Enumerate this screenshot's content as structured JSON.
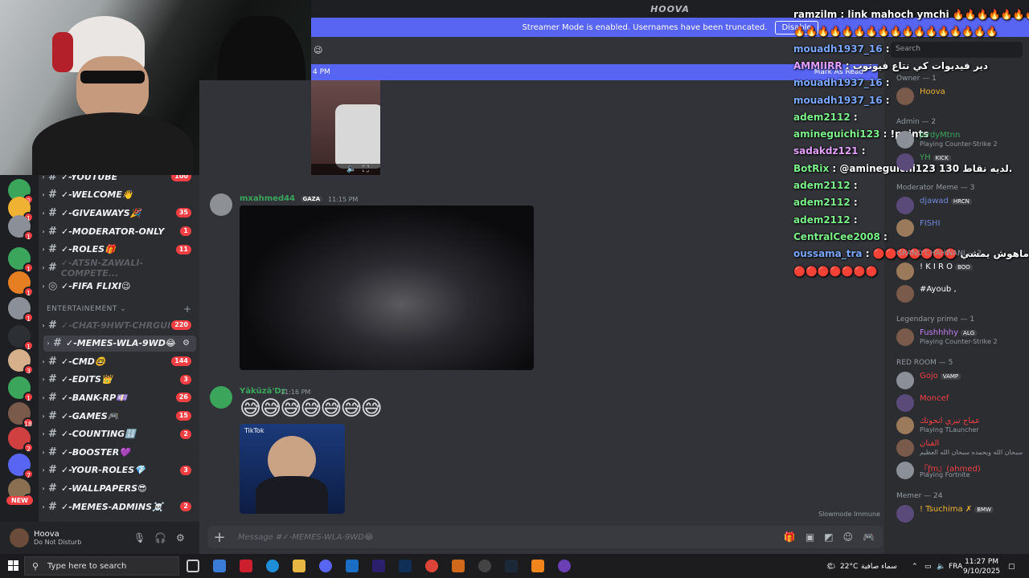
{
  "window": {
    "title": "HOOVA"
  },
  "streamer_mode": {
    "text": "Streamer Mode is enabled. Usernames have been truncated.",
    "button": "Disable"
  },
  "new_messages": {
    "time": "4 PM",
    "mark_read": "Mark As Read"
  },
  "channels": [
    {
      "name": "✓-YOUTUBE",
      "count": "100"
    },
    {
      "name": "✓-WELCOME👋",
      "count": ""
    },
    {
      "name": "✓-GIVEAWAYS🎉",
      "count": "35"
    },
    {
      "name": "✓-MODERATOR-ONLY",
      "count": "1"
    },
    {
      "name": "✓-ROLES🎁",
      "count": "11"
    },
    {
      "name": "✓-ATSN-ZAWALI-COMPETE...",
      "count": ""
    },
    {
      "name": "✓-FIFA FLIXI😉",
      "count": ""
    }
  ],
  "category": {
    "name": "ENTERTAINEMENT",
    "chevron": "⌄",
    "plus": "+"
  },
  "channels2": [
    {
      "name": "✓-CHAT-9HWT-CHRGUI",
      "count": "220"
    },
    {
      "name": "✓-MEMES-WLA-9WD😂",
      "count": ""
    },
    {
      "name": "✓-CMD🤓",
      "count": "144"
    },
    {
      "name": "✓-EDITS👑",
      "count": "3"
    },
    {
      "name": "✓-BANK-RP💷",
      "count": "26"
    },
    {
      "name": "✓-GAMES🎮",
      "count": "15"
    },
    {
      "name": "✓-COUNTING🔢",
      "count": "2"
    },
    {
      "name": "✓-BOOSTER💜",
      "count": ""
    },
    {
      "name": "✓-YOUR-ROLES💎",
      "count": "3"
    },
    {
      "name": "✓-WALLPAPERS😎",
      "count": ""
    },
    {
      "name": "✓-MEMES-ADMINS☠️",
      "count": "2"
    }
  ],
  "server_badges": [
    "2",
    "1",
    "1",
    "1",
    "1",
    "1",
    "1",
    "3",
    "1",
    "18",
    "2",
    "7",
    "1"
  ],
  "new_pill": "NEW",
  "user": {
    "name": "Hoova",
    "status": "Do Not Disturb"
  },
  "messages": [
    {
      "author": "mxahmed44",
      "tag": "GAZA",
      "time": "11:15 PM",
      "color": "#3ba55c"
    },
    {
      "author": "Yākūzā'Dz",
      "time": "11:16 PM",
      "color": "#3ba55c",
      "emojis": "😅😅😅😅😅😅😅",
      "embed_label": "TikTok"
    }
  ],
  "composer": {
    "placeholder": "Message #✓-MEMES-WLA-9WD😂"
  },
  "slowmode": "Slowmode Immune",
  "stream_chat": [
    {
      "user": "ramzilm",
      "text": "link mahoch ymchi 🔥🔥🔥🔥🔥🔥🔥🔥",
      "ucolor": "white"
    },
    {
      "user": "",
      "text": "🔥🔥🔥🔥🔥🔥🔥🔥🔥🔥🔥🔥🔥🔥🔥🔥🔥",
      "ucolor": "white"
    },
    {
      "user": "mouadh1937_16",
      "text": "",
      "ucolor": "blue"
    },
    {
      "user": "AMMIIRR",
      "text": "دير فيديوات كي نتاع فيوتوب",
      "ucolor": "pink"
    },
    {
      "user": "mouadh1937_16",
      "text": "",
      "ucolor": "blue"
    },
    {
      "user": "mouadh1937_16",
      "text": "",
      "ucolor": "blue"
    },
    {
      "user": "adem2112",
      "text": "",
      "ucolor": "green"
    },
    {
      "user": "amineguichi123",
      "text": "!points",
      "ucolor": "green"
    },
    {
      "user": "sadakdz121",
      "text": "",
      "ucolor": "pink"
    },
    {
      "user": "BotRix",
      "text": "@amineguichi123 لديه نقاط 130.",
      "ucolor": "green"
    },
    {
      "user": "adem2112",
      "text": "",
      "ucolor": "green"
    },
    {
      "user": "adem2112",
      "text": "",
      "ucolor": "green"
    },
    {
      "user": "adem2112",
      "text": "",
      "ucolor": "green"
    },
    {
      "user": "CentralCee2008",
      "text": "",
      "ucolor": "green"
    },
    {
      "user": "oussama_tra",
      "text": "🔴🔴🔴🔴🔴🔴🔴 اللينك ماهوش يمشي",
      "ucolor": "blue"
    },
    {
      "user": "",
      "text": "🔴🔴🔴🔴🔴🔴🔴",
      "ucolor": "white"
    }
  ],
  "member_search": "Search",
  "member_groups": [
    {
      "title": "Owner — 1",
      "members": [
        {
          "name": "Hoova",
          "status": "",
          "color": "#f0b232"
        }
      ]
    },
    {
      "title": "Admin — 2",
      "members": [
        {
          "name": "jordyMtnn",
          "status": "Playing Counter-Strike 2",
          "color": "#3ba55c"
        },
        {
          "name": "YH",
          "status": "",
          "color": "#3ba55c",
          "tag": "KICK"
        }
      ]
    },
    {
      "title": "Moderator Meme — 3",
      "members": [
        {
          "name": "djawad",
          "status": "",
          "color": "#7289da",
          "tag": "HRCN"
        },
        {
          "name": "FISHI",
          "status": "",
          "color": "#7289da"
        }
      ]
    },
    {
      "title": "GRAND CHAHWANI — 2",
      "members": [
        {
          "name": "! K I R O",
          "status": "",
          "color": "#ffffff",
          "tag": "BOO"
        },
        {
          "name": "#Ayoub ,",
          "status": "",
          "color": "#ffffff"
        }
      ]
    },
    {
      "title": "Legendary prime — 1",
      "members": [
        {
          "name": "Fushhhhy",
          "status": "Playing Counter-Strike 2",
          "color": "#c27cf2",
          "tag": "ALG"
        }
      ]
    },
    {
      "title": "RED ROOM — 5",
      "members": [
        {
          "name": "Gojo",
          "status": "",
          "color": "#f23f43",
          "tag": "VAMP"
        },
        {
          "name": "Moncef",
          "status": "",
          "color": "#f23f43"
        },
        {
          "name": "عماج تبزي انحوتك",
          "status": "Playing TLauncher",
          "color": "#f23f43"
        },
        {
          "name": "الفنان",
          "status": "سبحان الله وبحمده سبحان الله العظيم",
          "color": "#f23f43"
        },
        {
          "name": "『ƒm』(ahmed)",
          "status": "Playing Fortnite",
          "color": "#f23f43"
        }
      ]
    },
    {
      "title": "Memer — 24",
      "members": [
        {
          "name": "! Tsuchima ✗",
          "status": "",
          "color": "#f0b232",
          "tag": "BMW"
        }
      ]
    }
  ],
  "taskbar": {
    "search": "Type here to search",
    "temp": "22°C",
    "weather": "سماء صافية",
    "lang": "FRA",
    "time": "11:27 PM",
    "date": "9/10/2025"
  }
}
